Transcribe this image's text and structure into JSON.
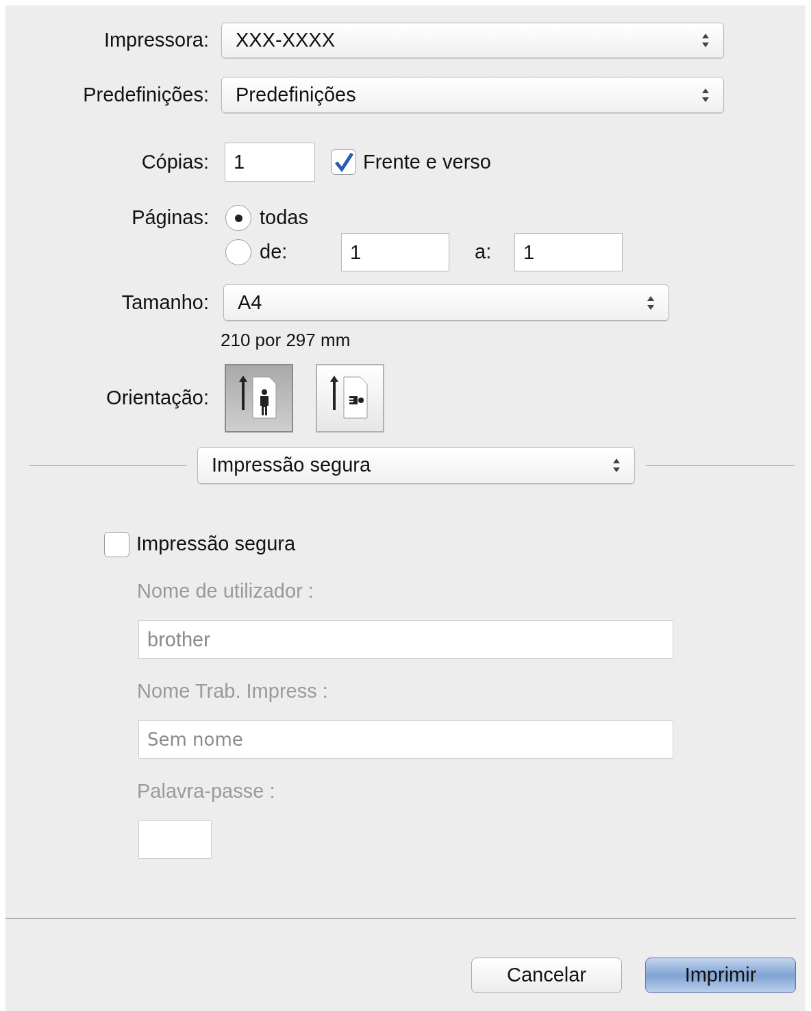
{
  "printer": {
    "label": "Impressora:",
    "value": "XXX-XXXX"
  },
  "presets": {
    "label": "Predefinições:",
    "value": "Predefinições"
  },
  "copies": {
    "label": "Cópias:",
    "value": "1"
  },
  "two_sided": {
    "label": "Frente e verso",
    "checked": true
  },
  "pages": {
    "label": "Páginas:",
    "options": [
      {
        "label": "todas",
        "selected": true
      },
      {
        "label": "de:",
        "selected": false
      }
    ],
    "from": "1",
    "to_label": "a:",
    "to": "1"
  },
  "paper_size": {
    "label": "Tamanho:",
    "value": "A4",
    "dimensions": "210 por 297 mm"
  },
  "orientation": {
    "label": "Orientação:",
    "options": [
      {
        "kind": "portrait",
        "selected": true
      },
      {
        "kind": "landscape",
        "selected": false
      }
    ]
  },
  "section_menu": {
    "value": "Impressão segura"
  },
  "secure_print": {
    "label": "Impressão segura",
    "checked": false,
    "fields": [
      {
        "label": "Nome de utilizador :",
        "value": "brother",
        "kind": "wide",
        "disabled": true
      },
      {
        "label": "Nome Trab. Impress :",
        "placeholder": "Sem nome",
        "kind": "wide",
        "disabled": true
      },
      {
        "label": "Palavra-passe :",
        "kind": "short",
        "disabled": true
      }
    ]
  },
  "buttons": [
    {
      "label": "Cancelar",
      "default": false
    },
    {
      "label": "Imprimir",
      "default": true
    }
  ]
}
